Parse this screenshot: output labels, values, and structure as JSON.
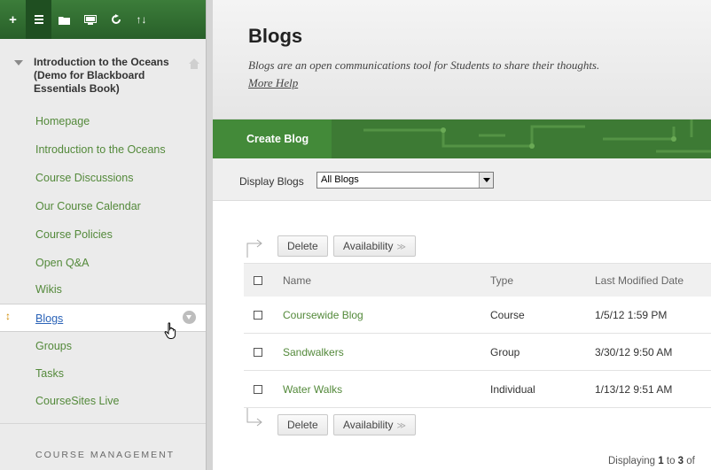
{
  "toolbar": {
    "buttons": [
      "add",
      "list",
      "folder",
      "screen",
      "refresh",
      "sort"
    ],
    "add_glyph": "+",
    "sort_glyph": "↑↓"
  },
  "course": {
    "title": "Introduction to the Oceans (Demo for Blackboard Essentials Book)"
  },
  "nav": {
    "items": [
      {
        "label": "Homepage"
      },
      {
        "label": "Introduction to the Oceans"
      },
      {
        "label": "Course Discussions"
      },
      {
        "label": "Our Course Calendar"
      },
      {
        "label": "Course Policies"
      },
      {
        "label": "Open Q&A"
      },
      {
        "label": "Wikis"
      },
      {
        "label": "Blogs",
        "selected": true
      },
      {
        "label": "Groups"
      },
      {
        "label": "Tasks"
      },
      {
        "label": "CourseSites Live"
      }
    ],
    "section_label": "COURSE MANAGEMENT"
  },
  "page": {
    "title": "Blogs",
    "description": "Blogs are an open communications tool for Students to share their thoughts.",
    "more_help": "More Help"
  },
  "actions": {
    "create_blog": "Create Blog"
  },
  "filter": {
    "label": "Display Blogs",
    "selected": "All Blogs"
  },
  "bulk": {
    "delete": "Delete",
    "availability": "Availability"
  },
  "table": {
    "columns": [
      "Name",
      "Type",
      "Last Modified Date"
    ],
    "rows": [
      {
        "name": "Coursewide Blog",
        "type": "Course",
        "modified": "1/5/12 1:59 PM"
      },
      {
        "name": "Sandwalkers",
        "type": "Group",
        "modified": "3/30/12 9:50 AM"
      },
      {
        "name": "Water Walks",
        "type": "Individual",
        "modified": "1/13/12 9:51 AM"
      }
    ]
  },
  "footer": {
    "displaying": "Displaying",
    "from": "1",
    "to_word": "to",
    "to": "3",
    "of_word": "of"
  },
  "colors": {
    "brand_green": "#3d7a34",
    "link_green": "#53893a",
    "selected_link": "#2c64b8"
  }
}
